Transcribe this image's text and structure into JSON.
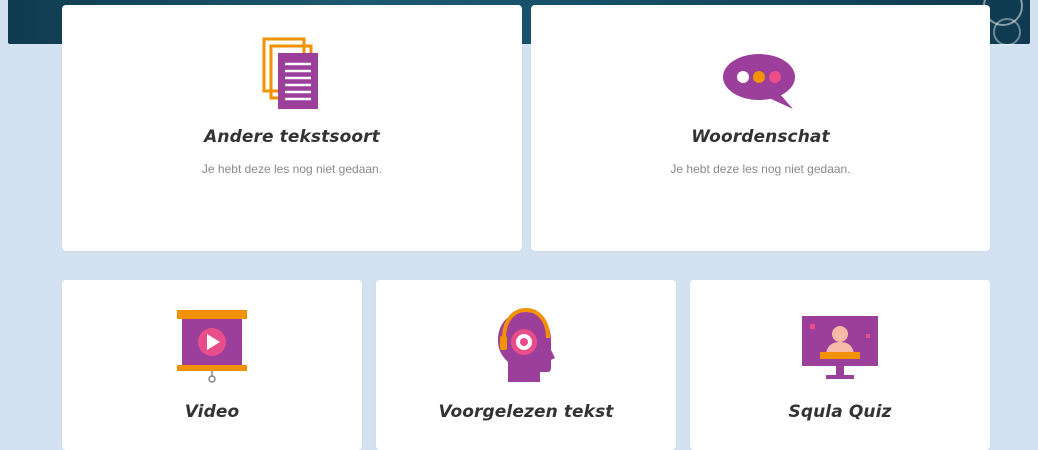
{
  "colors": {
    "background": "#d3e1f1",
    "card": "#ffffff",
    "accent_purple": "#9b3f9a",
    "accent_orange": "#f39200",
    "accent_pink": "#e94e8a",
    "title_text": "#333333",
    "status_text": "#8a8a8a"
  },
  "lessons": [
    {
      "title": "Andere tekstsoort",
      "status": "Je hebt deze les nog niet gedaan.",
      "icon": "documents-icon"
    },
    {
      "title": "Woordenschat",
      "status": "Je hebt deze les nog niet gedaan.",
      "icon": "speech-bubble-icon"
    },
    {
      "title": "Video",
      "icon": "video-screen-icon"
    },
    {
      "title": "Voorgelezen tekst",
      "icon": "headphones-head-icon"
    },
    {
      "title": "Squla Quiz",
      "icon": "quiz-monitor-icon"
    }
  ]
}
